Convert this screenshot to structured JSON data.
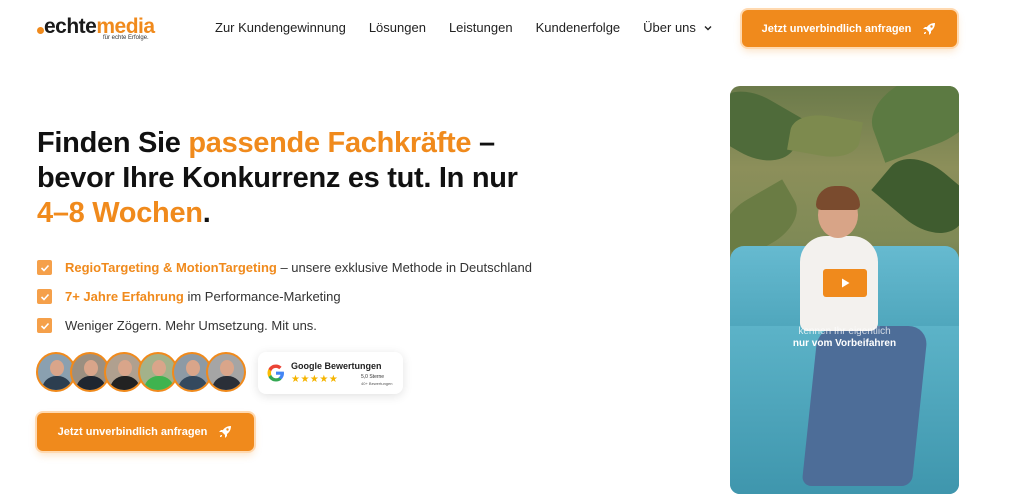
{
  "brand": {
    "logo_part1": "echte",
    "logo_part2": "media",
    "tagline": "für echte Erfolge."
  },
  "nav": {
    "items": [
      {
        "label": "Zur Kundengewinnung"
      },
      {
        "label": "Lösungen"
      },
      {
        "label": "Leistungen"
      },
      {
        "label": "Kundenerfolge"
      },
      {
        "label": "Über uns"
      }
    ],
    "cta_label": "Jetzt unverbindlich anfragen"
  },
  "hero": {
    "title_1": "Finden Sie ",
    "title_accent_1": "passende Fachkräfte",
    "title_2": " – bevor Ihre Konkurrenz es tut. In nur ",
    "title_accent_2": "4–8 Wochen",
    "title_3": ".",
    "bullets": [
      {
        "highlight": "RegioTargeting & MotionTargeting",
        "text": " – unsere exklusive Methode in Deutschland"
      },
      {
        "highlight": "7+ Jahre Erfahrung",
        "text": " im Performance-Marketing"
      },
      {
        "highlight": "",
        "text": "Weniger Zögern. Mehr Umsetzung. Mit uns."
      }
    ],
    "cta_label": "Jetzt unverbindlich anfragen"
  },
  "reviews": {
    "title": "Google Bewertungen",
    "stars": "★★★★★",
    "rating": "5,0 Sterne",
    "count": "40+ Bewertungen"
  },
  "video": {
    "caption_line1": "kennen Ihr eigentlich",
    "caption_line2": "nur vom Vorbeifahren"
  },
  "colors": {
    "accent": "#f08a1c",
    "text": "#111111"
  }
}
